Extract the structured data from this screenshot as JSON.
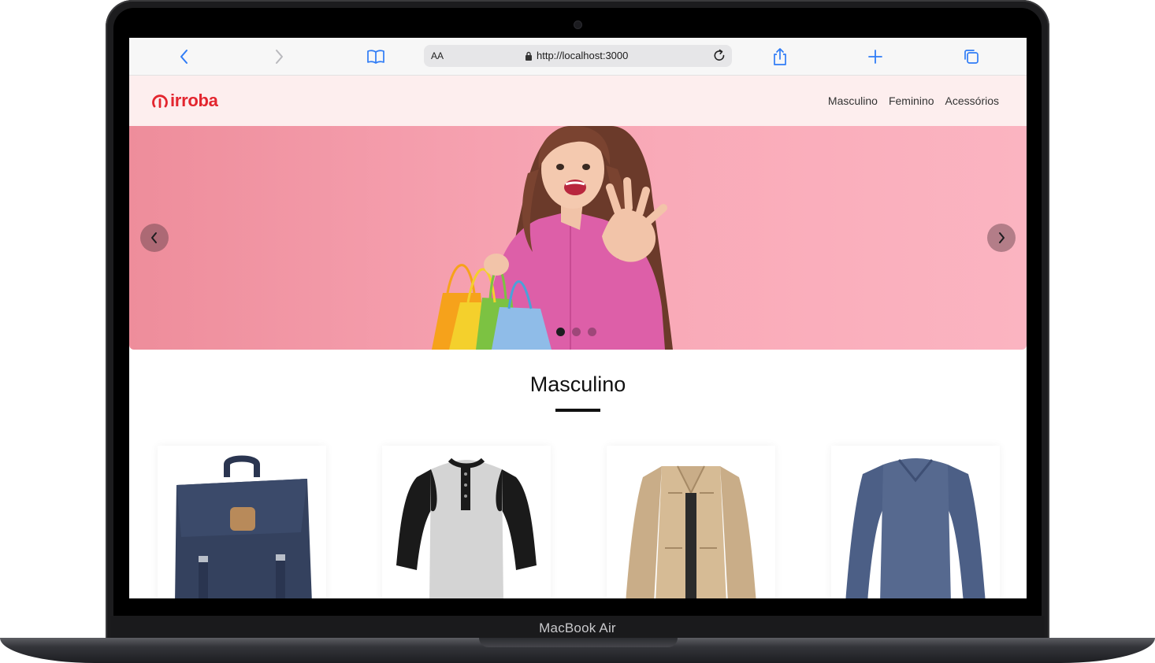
{
  "device": {
    "label": "MacBook Air"
  },
  "browser": {
    "reader_label": "AA",
    "url": "http://localhost:3000"
  },
  "site": {
    "brand": "irroba",
    "brand_color": "#e3262f",
    "nav": [
      {
        "label": "Masculino"
      },
      {
        "label": "Feminino"
      },
      {
        "label": "Acessórios"
      }
    ]
  },
  "hero": {
    "slides_total": 3,
    "active_slide": 1,
    "background": "#f59fae"
  },
  "section": {
    "title": "Masculino"
  },
  "products": [
    {
      "icon": "backpack-icon"
    },
    {
      "icon": "raglan-shirt-icon"
    },
    {
      "icon": "jacket-icon"
    },
    {
      "icon": "sweater-icon"
    }
  ]
}
